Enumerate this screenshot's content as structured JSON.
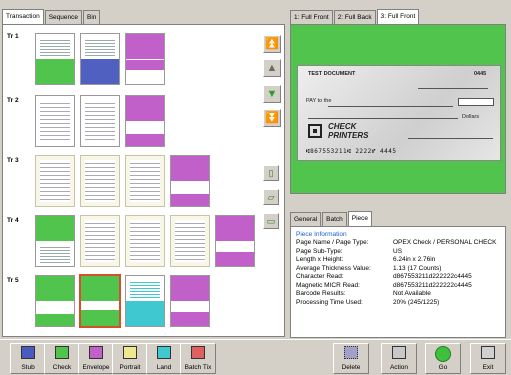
{
  "left_tabs": [
    "Transaction",
    "Sequence",
    "Bin"
  ],
  "rows": [
    {
      "label": "Tr 1"
    },
    {
      "label": "Tr 2"
    },
    {
      "label": "Tr 3"
    },
    {
      "label": "Tr 4"
    },
    {
      "label": "Tr 5"
    }
  ],
  "right_tabs": [
    "1: Full Front",
    "2: Full Back",
    "3: Full Front"
  ],
  "check": {
    "header": "TEST DOCUMENT",
    "number": "0445",
    "payto": "PAY to the",
    "dollars": "Dollars",
    "brand_line1": "CHECK",
    "brand_line2": "PRINTERS",
    "micr": "⑆867553211⑆  2222⑈  4445"
  },
  "info_tabs": [
    "General",
    "Batch",
    "Piece"
  ],
  "piece_info": {
    "title": "Piece Information",
    "fields": [
      {
        "k": "Page Name / Page Type:",
        "v": "OPEX Check / PERSONAL CHECK"
      },
      {
        "k": "Page Sub-Type:",
        "v": "US"
      },
      {
        "k": "Length x Height:",
        "v": "6.24in x 2.76in"
      },
      {
        "k": "Average Thickness Value:",
        "v": "1.13 (17 Counts)"
      },
      {
        "k": "Character Read:",
        "v": "d867553211d222222c4445"
      },
      {
        "k": "Magnetic MICR Read:",
        "v": "d867553211d222222c4445"
      },
      {
        "k": "Barcode Results:",
        "v": "Not Available"
      },
      {
        "k": "Processing Time Used:",
        "v": "20% (245/1225)"
      }
    ]
  },
  "toolbar": {
    "stub": "Stub",
    "check": "Check",
    "envelope": "Envelope",
    "portrait": "Portrait",
    "land": "Land",
    "batch_tix": "Batch Tix",
    "delete": "Delete",
    "action": "Action",
    "go": "Go",
    "exit": "Exit"
  },
  "colors": {
    "green": "#51c44d",
    "blue": "#5060c0",
    "purple": "#c060c8",
    "cyan": "#40c8d0",
    "selected": "#d4502a"
  }
}
